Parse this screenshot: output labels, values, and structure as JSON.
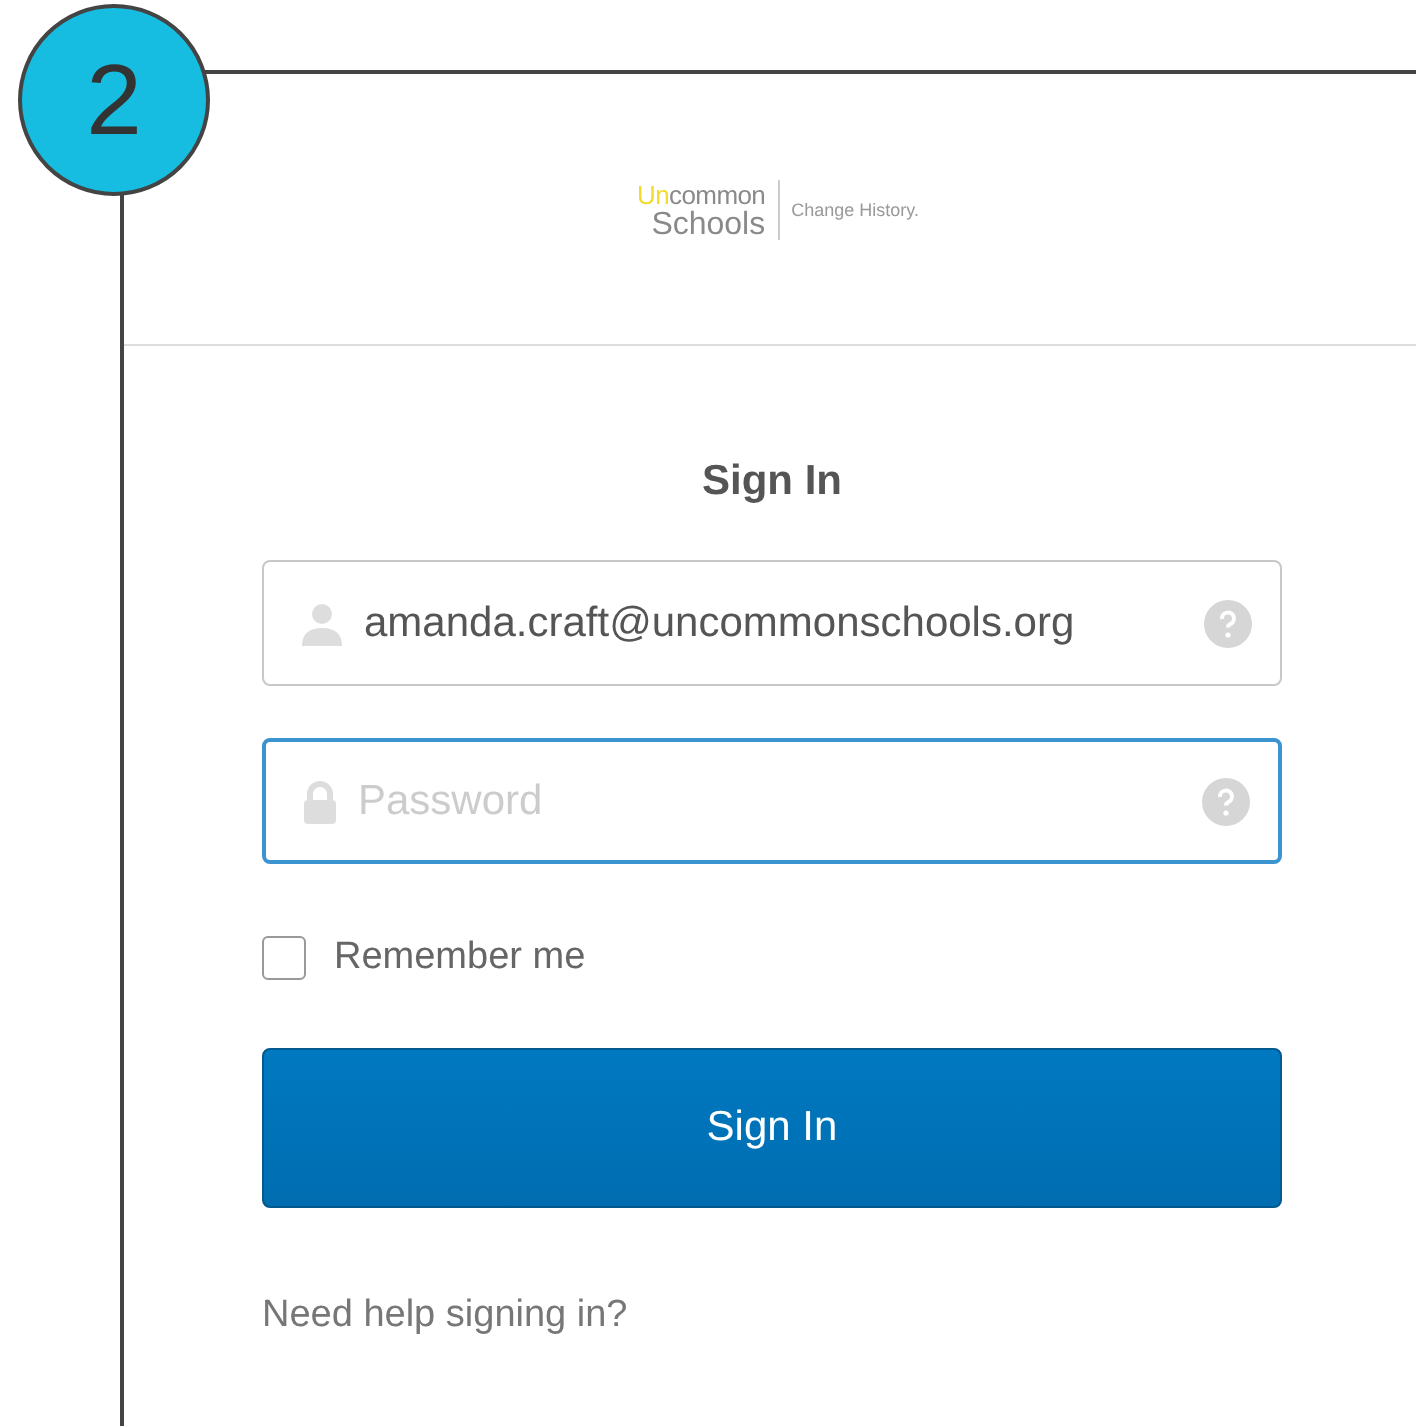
{
  "step_badge": "2",
  "logo": {
    "accent": "Un",
    "word_1_rest": "common",
    "word_2": "Schools",
    "tagline": "Change History."
  },
  "title": "Sign In",
  "fields": [
    {
      "kind": "username",
      "value": "amanda.craft@uncommonschools.org",
      "focused": false
    },
    {
      "kind": "password",
      "placeholder": "Password",
      "focused": true
    }
  ],
  "remember": {
    "label": "Remember me",
    "checked": false
  },
  "submit": "Sign In",
  "help_link": "Need help signing in?"
}
